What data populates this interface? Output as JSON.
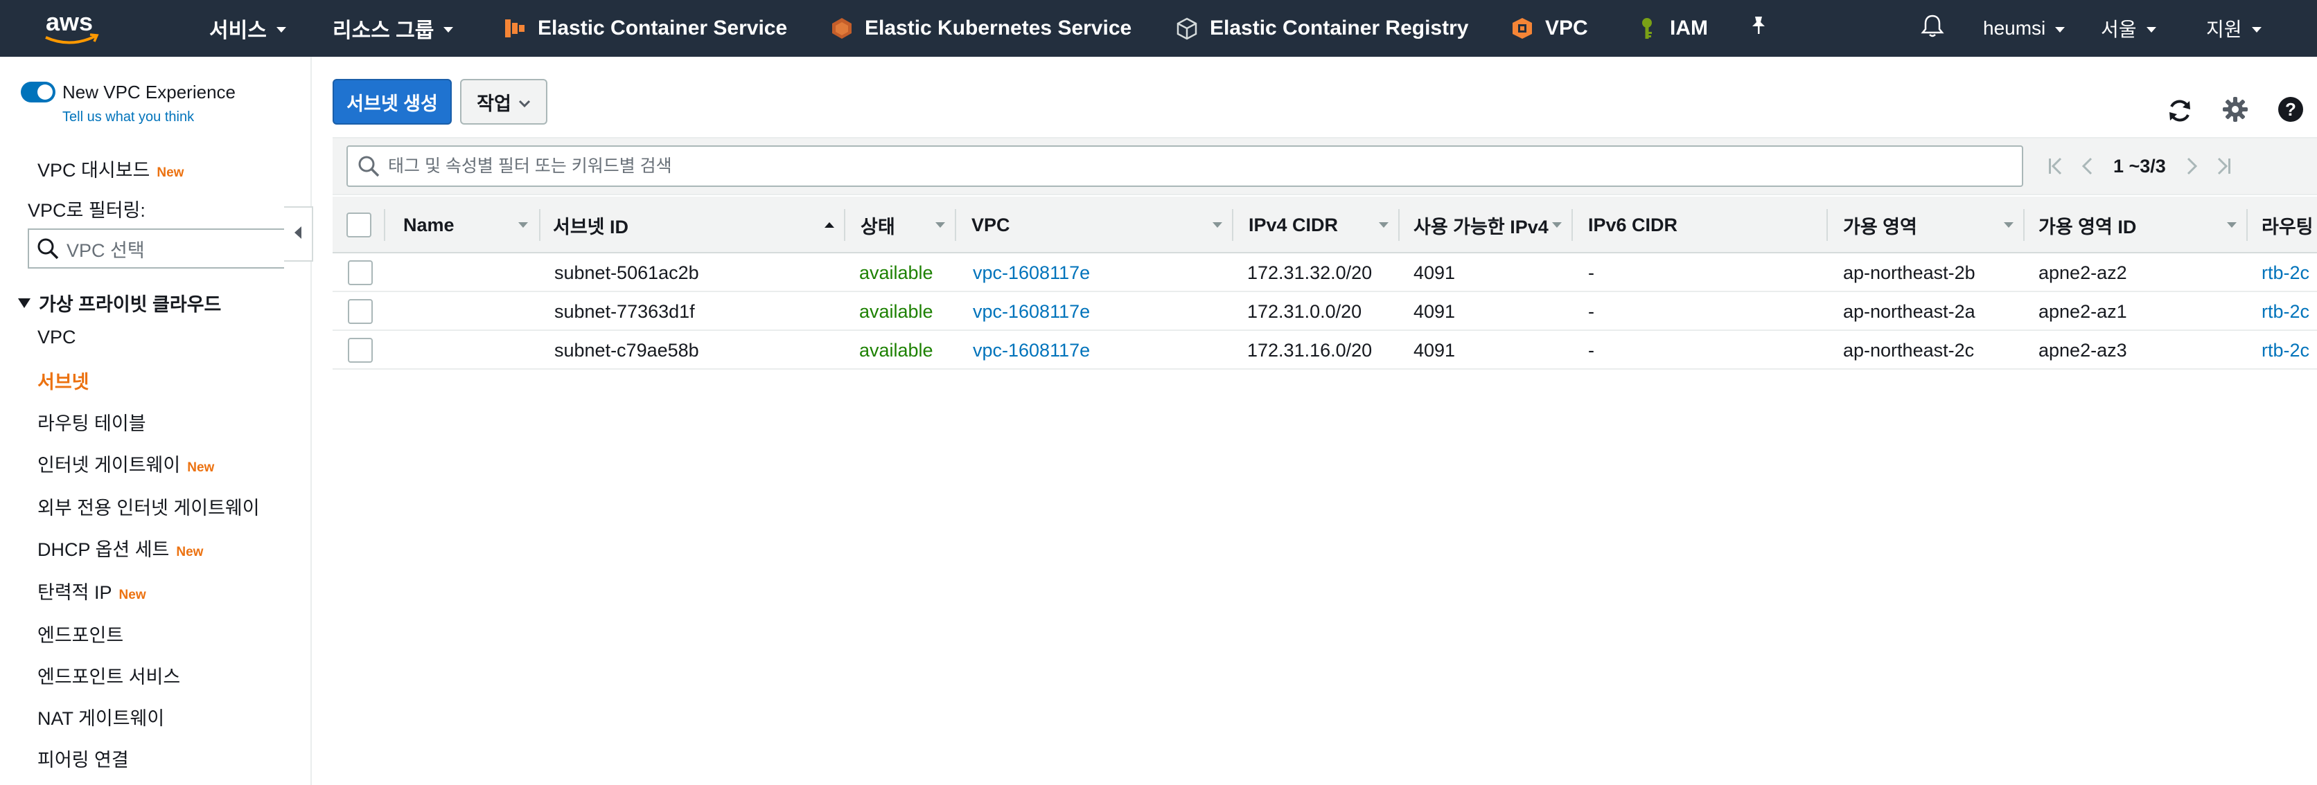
{
  "colors": {
    "nav_bg": "#232f3e",
    "accent": "#ec7211",
    "link": "#0073bb",
    "primary": "#1f73d0",
    "status_ok": "#1d8102"
  },
  "topnav": {
    "logo": "aws",
    "services": "서비스",
    "resource_groups": "리소스 그룹",
    "shortcuts": [
      {
        "label": "Elastic Container Service",
        "icon": "ecs-icon"
      },
      {
        "label": "Elastic Kubernetes Service",
        "icon": "eks-icon"
      },
      {
        "label": "Elastic Container Registry",
        "icon": "ecr-icon"
      },
      {
        "label": "VPC",
        "icon": "vpc-icon"
      },
      {
        "label": "IAM",
        "icon": "iam-icon"
      }
    ],
    "user": "heumsi",
    "region": "서울",
    "support": "지원"
  },
  "sidebar": {
    "experience_title": "New VPC Experience",
    "experience_link": "Tell us what you think",
    "dashboard": "VPC 대시보드",
    "new_badge": "New",
    "filter_label": "VPC로 필터링:",
    "filter_placeholder": "VPC 선택",
    "section": "가상 프라이빗 클라우드",
    "items": [
      {
        "label": "VPC",
        "new": ""
      },
      {
        "label": "서브넷",
        "new": ""
      },
      {
        "label": "라우팅 테이블",
        "new": ""
      },
      {
        "label": "인터넷 게이트웨이",
        "new": "New"
      },
      {
        "label": "외부 전용 인터넷 게이트웨이",
        "new": ""
      },
      {
        "label": "DHCP 옵션 세트",
        "new": "New"
      },
      {
        "label": "탄력적 IP",
        "new": "New"
      },
      {
        "label": "엔드포인트",
        "new": ""
      },
      {
        "label": "엔드포인트 서비스",
        "new": ""
      },
      {
        "label": "NAT 게이트웨이",
        "new": ""
      },
      {
        "label": "피어링 연결",
        "new": ""
      }
    ]
  },
  "toolbar": {
    "create": "서브넷 생성",
    "actions": "작업"
  },
  "search": {
    "placeholder": "태그 및 속성별 필터 또는 키워드별 검색"
  },
  "pagination": {
    "text": "1 ~3/3"
  },
  "table": {
    "columns": [
      "Name",
      "서브넷 ID",
      "상태",
      "VPC",
      "IPv4 CIDR",
      "사용 가능한 IPv4",
      "IPv6 CIDR",
      "가용 영역",
      "가용 영역 ID",
      "라우팅"
    ],
    "rows": [
      {
        "name": "",
        "subnet_id": "subnet-5061ac2b",
        "state": "available",
        "vpc": "vpc-1608117e",
        "ipv4_cidr": "172.31.32.0/20",
        "available_ipv4": "4091",
        "ipv6_cidr": "-",
        "az": "ap-northeast-2b",
        "az_id": "apne2-az2",
        "route": "rtb-2c"
      },
      {
        "name": "",
        "subnet_id": "subnet-77363d1f",
        "state": "available",
        "vpc": "vpc-1608117e",
        "ipv4_cidr": "172.31.0.0/20",
        "available_ipv4": "4091",
        "ipv6_cidr": "-",
        "az": "ap-northeast-2a",
        "az_id": "apne2-az1",
        "route": "rtb-2c"
      },
      {
        "name": "",
        "subnet_id": "subnet-c79ae58b",
        "state": "available",
        "vpc": "vpc-1608117e",
        "ipv4_cidr": "172.31.16.0/20",
        "available_ipv4": "4091",
        "ipv6_cidr": "-",
        "az": "ap-northeast-2c",
        "az_id": "apne2-az3",
        "route": "rtb-2c"
      }
    ]
  }
}
